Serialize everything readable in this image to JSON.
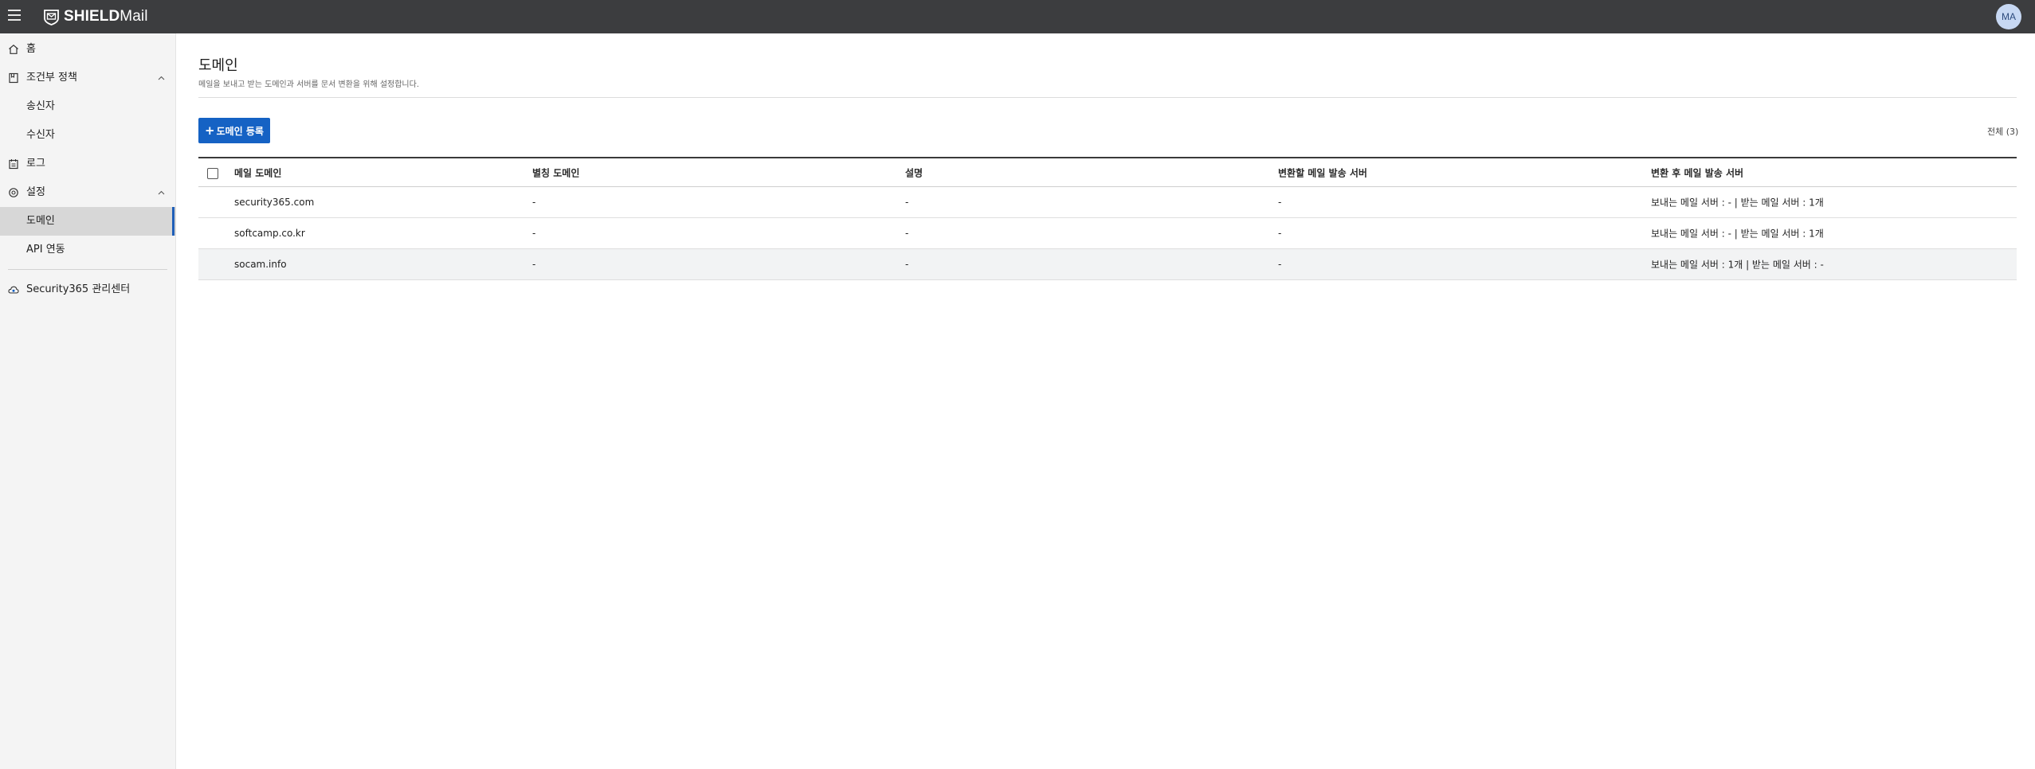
{
  "header": {
    "logo_bold": "SHIELD",
    "logo_light": "Mail",
    "avatar_initials": "MA",
    "background_color": "#3c3d3f"
  },
  "sidebar": {
    "items": [
      {
        "label": "홈",
        "icon": "home-icon"
      },
      {
        "label": "조건부 정책",
        "icon": "policy-icon",
        "expanded": true
      },
      {
        "label": "송신자",
        "sub": true
      },
      {
        "label": "수신자",
        "sub": true
      },
      {
        "label": "로그",
        "icon": "log-icon"
      },
      {
        "label": "설정",
        "icon": "gear-icon",
        "expanded": true
      },
      {
        "label": "도메인",
        "sub": true,
        "active": true
      },
      {
        "label": "API 연동",
        "sub": true
      },
      {
        "label": "Security365 관리센터",
        "icon": "cloud-icon"
      }
    ]
  },
  "main": {
    "title": "도메인",
    "description": "메일을 보내고 받는 도메인과 서버를 문서 변환을 위해 설정합니다.",
    "add_button": {
      "plus": "+",
      "label": "도메인 등록"
    },
    "total_label": "전체 (3)",
    "accent_color": "#1562c4",
    "table": {
      "columns": [
        "메일 도메인",
        "별칭 도메인",
        "설명",
        "변환할 메일 발송 서버",
        "변환 후 메일 발송 서버"
      ],
      "rows": [
        [
          "security365.com",
          "-",
          "-",
          "-",
          "보내는 메일 서버 : - | 받는 메일 서버 : 1개"
        ],
        [
          "softcamp.co.kr",
          "-",
          "-",
          "-",
          "보내는 메일 서버 : - | 받는 메일 서버 : 1개"
        ],
        [
          "socam.info",
          "-",
          "-",
          "-",
          "보내는 메일 서버 : 1개 | 받는 메일 서버 : -"
        ]
      ]
    }
  }
}
